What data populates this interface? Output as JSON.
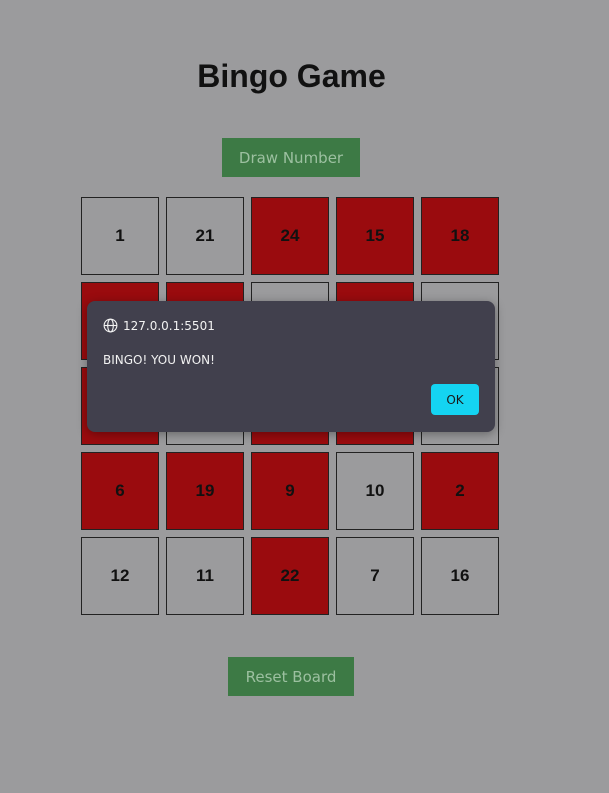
{
  "title": "Bingo Game",
  "draw_button": "Draw Number",
  "reset_button": "Reset Board",
  "board": [
    {
      "n": "1",
      "marked": false
    },
    {
      "n": "21",
      "marked": false
    },
    {
      "n": "24",
      "marked": true
    },
    {
      "n": "15",
      "marked": true
    },
    {
      "n": "18",
      "marked": true
    },
    {
      "n": "",
      "marked": true
    },
    {
      "n": "",
      "marked": true
    },
    {
      "n": "",
      "marked": false
    },
    {
      "n": "",
      "marked": true
    },
    {
      "n": "",
      "marked": false
    },
    {
      "n": "",
      "marked": true
    },
    {
      "n": "",
      "marked": false
    },
    {
      "n": "",
      "marked": true
    },
    {
      "n": "",
      "marked": true
    },
    {
      "n": "",
      "marked": false
    },
    {
      "n": "6",
      "marked": true
    },
    {
      "n": "19",
      "marked": true
    },
    {
      "n": "9",
      "marked": true
    },
    {
      "n": "10",
      "marked": false
    },
    {
      "n": "2",
      "marked": true
    },
    {
      "n": "12",
      "marked": false
    },
    {
      "n": "11",
      "marked": false
    },
    {
      "n": "22",
      "marked": true
    },
    {
      "n": "7",
      "marked": false
    },
    {
      "n": "16",
      "marked": false
    }
  ],
  "dialog": {
    "origin": "127.0.0.1:5501",
    "message": "BINGO! YOU WON!",
    "ok_label": "OK"
  },
  "colors": {
    "background": "#9b9b9d",
    "marked": "#9a0b0e",
    "button": "#3d7a45",
    "ok_button": "#14d4f2",
    "dialog": "#41404d"
  }
}
